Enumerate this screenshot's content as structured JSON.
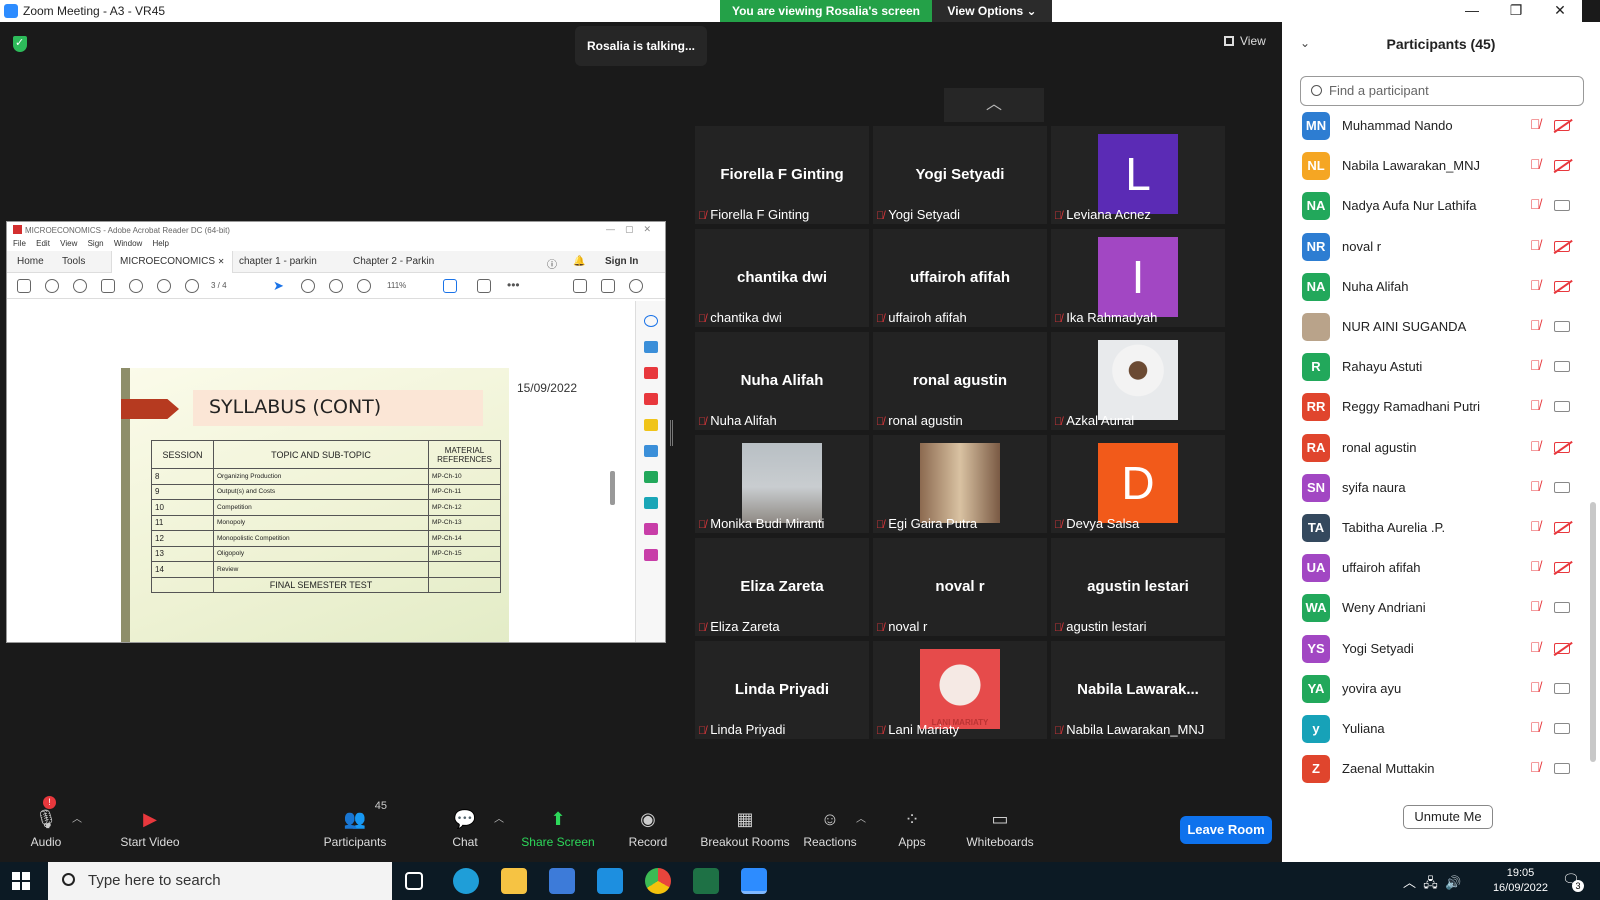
{
  "window": {
    "title": "Zoom Meeting - A3 - VR45",
    "banner": "You are viewing Rosalia's screen",
    "view_options": "View Options ⌄"
  },
  "stage": {
    "talking": "Rosalia is talking...",
    "view_label": "View"
  },
  "acrobat": {
    "title": "MICROECONOMICS - Adobe Acrobat Reader DC (64-bit)",
    "menu": [
      "File",
      "Edit",
      "View",
      "Sign",
      "Window",
      "Help"
    ],
    "tabs": {
      "home": "Home",
      "tools": "Tools",
      "doc1": "MICROECONOMICS",
      "doc2": "chapter 1 - parkin",
      "doc3": "Chapter 2 - Parkin",
      "signin": "Sign In"
    },
    "page_indicator": "3  /  4",
    "zoom": "111%",
    "date": "15/09/2022",
    "slide_title": "SYLLABUS (CONT)",
    "table_headers": [
      "SESSION",
      "TOPIC AND SUB-TOPIC",
      "MATERIAL REFERENCES"
    ],
    "rows": [
      [
        "8",
        "Organizing Production",
        "MP-Ch-10"
      ],
      [
        "9",
        "Output(s) and Costs",
        "MP-Ch-11"
      ],
      [
        "10",
        "Competition",
        "MP-Ch-12"
      ],
      [
        "11",
        "Monopoly",
        "MP-Ch-13"
      ],
      [
        "12",
        "Monopolistic Competition",
        "MP-Ch-14"
      ],
      [
        "13",
        "Oligopoly",
        "MP-Ch-15"
      ],
      [
        "14",
        "Review",
        ""
      ]
    ],
    "final_row": "FINAL SEMESTER TEST"
  },
  "tiles": [
    {
      "big": "Fiorella F Ginting",
      "label": "Fiorella F Ginting"
    },
    {
      "big": "Yogi Setyadi",
      "label": "Yogi Setyadi"
    },
    {
      "avatar_letter": "L",
      "avatar_color": "#5b2bb5",
      "label": "Leviana Acnez"
    },
    {
      "big": "chantika dwi",
      "label": "chantika dwi"
    },
    {
      "big": "uffairoh afifah",
      "label": "uffairoh afifah"
    },
    {
      "avatar_letter": "I",
      "avatar_color": "#a247c3",
      "label": "Ika Rahmadyah"
    },
    {
      "big": "Nuha Alifah",
      "label": "Nuha Alifah"
    },
    {
      "big": "ronal agustin",
      "label": "ronal agustin"
    },
    {
      "photo": "person-white-shirt",
      "label": "Azkal Aunal"
    },
    {
      "photo": "person-lake",
      "label": "Monika Budi Miranti"
    },
    {
      "photo": "person-sofa",
      "label": "Egi Gaira Putra"
    },
    {
      "avatar_letter": "D",
      "avatar_color": "#f25a1a",
      "label": "Devya Salsa"
    },
    {
      "big": "Eliza Zareta",
      "label": "Eliza Zareta"
    },
    {
      "big": "noval r",
      "label": "noval r"
    },
    {
      "big": "agustin lestari",
      "label": "agustin lestari"
    },
    {
      "big": "Linda Priyadi",
      "label": "Linda Priyadi"
    },
    {
      "photo": "person-red-circle",
      "label": "Lani Mariaty",
      "photo_text": "LANI MARIATY"
    },
    {
      "big": "Nabila  Lawarak...",
      "label": "Nabila Lawarakan_MNJ"
    }
  ],
  "participants": {
    "header": "Participants (45)",
    "search_placeholder": "Find a participant",
    "unmute": "Unmute Me",
    "list": [
      {
        "initials": "MN",
        "color": "#2d7dd2",
        "name": "Muhammad Nando",
        "cam_off": true
      },
      {
        "initials": "NL",
        "color": "#f5a623",
        "name": "Nabila Lawarakan_MNJ",
        "cam_off": true
      },
      {
        "initials": "NA",
        "color": "#22a85b",
        "name": "Nadya Aufa Nur Lathifa",
        "cam_off": false
      },
      {
        "initials": "NR",
        "color": "#2d7dd2",
        "name": "noval r",
        "cam_off": true
      },
      {
        "initials": "NA",
        "color": "#22a85b",
        "name": "Nuha Alifah",
        "cam_off": true
      },
      {
        "initials": "",
        "color": "#b9a38a",
        "name": "NUR AINI SUGANDA",
        "cam_off": false
      },
      {
        "initials": "R",
        "color": "#22a85b",
        "name": "Rahayu Astuti",
        "cam_off": false
      },
      {
        "initials": "RR",
        "color": "#e0452d",
        "name": "Reggy Ramadhani Putri",
        "cam_off": false
      },
      {
        "initials": "RA",
        "color": "#e0452d",
        "name": "ronal agustin",
        "cam_off": true
      },
      {
        "initials": "SN",
        "color": "#a247c3",
        "name": "syifa naura",
        "cam_off": false
      },
      {
        "initials": "TA",
        "color": "#34495e",
        "name": "Tabitha Aurelia .P.",
        "cam_off": true
      },
      {
        "initials": "UA",
        "color": "#a247c3",
        "name": "uffairoh afifah",
        "cam_off": true
      },
      {
        "initials": "WA",
        "color": "#22a85b",
        "name": "Weny Andriani",
        "cam_off": false
      },
      {
        "initials": "YS",
        "color": "#a247c3",
        "name": "Yogi Setyadi",
        "cam_off": true
      },
      {
        "initials": "YA",
        "color": "#22a85b",
        "name": "yovira ayu",
        "cam_off": false
      },
      {
        "initials": "y",
        "color": "#17a2b8",
        "name": "Yuliana",
        "cam_off": false
      },
      {
        "initials": "Z",
        "color": "#e0452d",
        "name": "Zaenal Muttakin",
        "cam_off": false
      }
    ]
  },
  "toolbar": {
    "audio": "Audio",
    "start_video": "Start Video",
    "participants": "Participants",
    "participants_count": "45",
    "chat": "Chat",
    "share_screen": "Share Screen",
    "record": "Record",
    "breakout": "Breakout Rooms",
    "reactions": "Reactions",
    "apps": "Apps",
    "whiteboards": "Whiteboards",
    "leave": "Leave Room"
  },
  "taskbar": {
    "search_placeholder": "Type here to search",
    "time": "19:05",
    "date": "16/09/2022",
    "notifications": "3"
  }
}
